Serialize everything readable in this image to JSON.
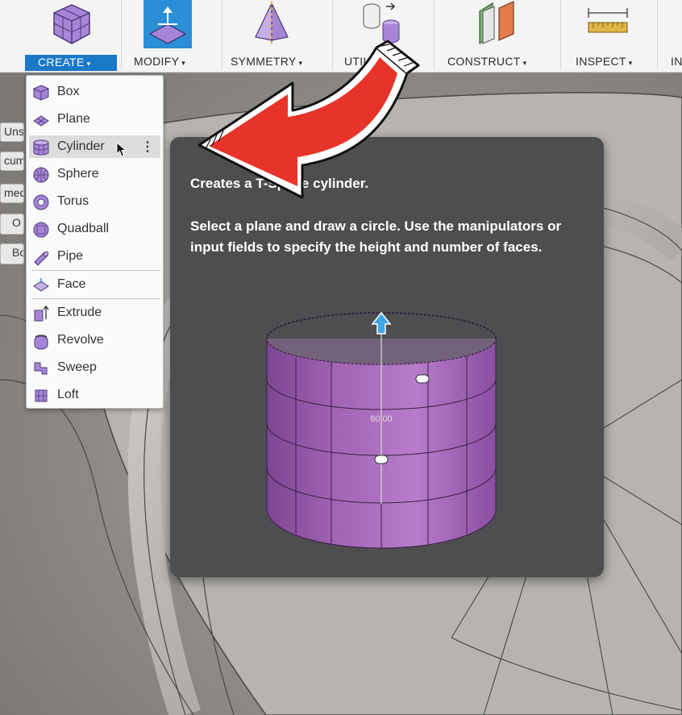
{
  "toolbar": {
    "groups": [
      {
        "label": "CREATE",
        "icon": "box-icon",
        "active": true
      },
      {
        "label": "MODIFY",
        "icon": "modify-icon"
      },
      {
        "label": "SYMMETRY",
        "icon": "symmetry-icon"
      },
      {
        "label": "UTILITIES",
        "icon": "utilities-icon"
      },
      {
        "label": "CONSTRUCT",
        "icon": "construct-plane-icon"
      },
      {
        "label": "INSPECT",
        "icon": "ruler-icon"
      },
      {
        "label": "INSERT",
        "icon": "insert-icon"
      }
    ],
    "caret": "▾"
  },
  "left_panel": {
    "stubs": [
      "Unsa",
      "cum",
      "med",
      "O",
      "Bo"
    ]
  },
  "create_menu": {
    "items": [
      {
        "label": "Box",
        "icon": "box-icon"
      },
      {
        "label": "Plane",
        "icon": "plane-icon"
      },
      {
        "label": "Cylinder",
        "icon": "cylinder-icon",
        "highlighted": true
      },
      {
        "label": "Sphere",
        "icon": "sphere-icon"
      },
      {
        "label": "Torus",
        "icon": "torus-icon"
      },
      {
        "label": "Quadball",
        "icon": "quadball-icon"
      },
      {
        "label": "Pipe",
        "icon": "pipe-icon"
      },
      {
        "label": "Face",
        "icon": "face-icon"
      },
      {
        "label": "Extrude",
        "icon": "extrude-icon"
      },
      {
        "label": "Revolve",
        "icon": "revolve-icon"
      },
      {
        "label": "Sweep",
        "icon": "sweep-icon"
      },
      {
        "label": "Loft",
        "icon": "loft-icon"
      }
    ],
    "more_options": "⋮"
  },
  "tooltip": {
    "title": "Creates a T-Spline cylinder.",
    "body": "Select a plane and draw a circle. Use the manipulators or input fields to specify the height and number of faces.",
    "dimension_value": "60.00"
  },
  "colors": {
    "accent": "#1a78c9",
    "tspline_purple": "#a264b5",
    "tooltip_bg": "#4e4d50",
    "annotation_arrow": "#e8332a"
  }
}
